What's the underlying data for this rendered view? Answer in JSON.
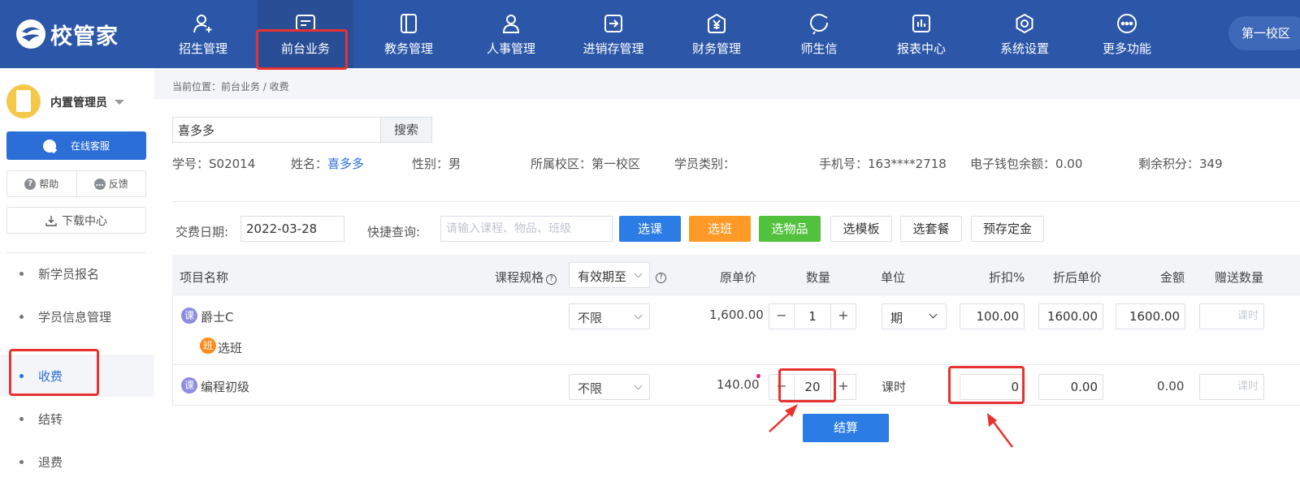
{
  "brand": {
    "name": "校管家"
  },
  "nav": {
    "items": [
      {
        "key": "recruit",
        "label": "招生管理",
        "icon": "user-plus-icon"
      },
      {
        "key": "front",
        "label": "前台业务",
        "icon": "front-desk-icon",
        "active": true
      },
      {
        "key": "academic",
        "label": "教务管理",
        "icon": "book-icon"
      },
      {
        "key": "hr",
        "label": "人事管理",
        "icon": "person-icon"
      },
      {
        "key": "inventory",
        "label": "进销存管理",
        "icon": "inventory-icon"
      },
      {
        "key": "finance",
        "label": "财务管理",
        "icon": "yen-icon"
      },
      {
        "key": "message",
        "label": "师生信",
        "icon": "message-icon"
      },
      {
        "key": "report",
        "label": "报表中心",
        "icon": "chart-icon"
      },
      {
        "key": "settings",
        "label": "系统设置",
        "icon": "gear-icon"
      },
      {
        "key": "more",
        "label": "更多功能",
        "icon": "more-icon"
      }
    ],
    "campus": "第一校区"
  },
  "sidebar": {
    "user_name": "内置管理员",
    "online_service": "在线客服",
    "help": "帮助",
    "feedback": "反馈",
    "download": "下载中心",
    "menu": [
      {
        "label": "新学员报名"
      },
      {
        "label": "学员信息管理"
      },
      {
        "label": "收费",
        "active": true
      },
      {
        "label": "结转"
      },
      {
        "label": "退费"
      }
    ]
  },
  "breadcrumb": "当前位置：前台业务 / 收费",
  "search": {
    "value": "喜多多",
    "button": "搜索"
  },
  "student": {
    "id_label": "学号：S02014",
    "name_label": "姓名：",
    "name_value": "喜多多",
    "gender": "性别：男",
    "campus": "所属校区：第一校区",
    "category": "学员类别：",
    "phone": "手机号：163****2718",
    "wallet": "电子钱包余额：0.00",
    "points": "剩余积分：349"
  },
  "filters": {
    "date_label": "交费日期:",
    "date_value": "2022-03-28",
    "quick_label": "快捷查询:",
    "quick_placeholder": "请输入课程、物品、班级",
    "buttons": {
      "course": "选课",
      "class": "选班",
      "goods": "选物品",
      "template": "选模板",
      "package": "选套餐",
      "deposit": "预存定金"
    }
  },
  "table": {
    "headers": {
      "name": "项目名称",
      "spec": "课程规格",
      "valid_until": "有效期至",
      "price": "原单价",
      "qty": "数量",
      "unit": "单位",
      "discount": "折扣%",
      "discounted_price": "折后单价",
      "amount": "金额",
      "gift_qty": "赠送数量"
    },
    "rows": [
      {
        "badge": "课",
        "name": "爵士C",
        "sub_badge": "班",
        "sub_label": "选班",
        "validity": "不限",
        "price": "1,600.00",
        "qty": "1",
        "unit": "期",
        "discount": "100.00",
        "discounted_price": "1600.00",
        "amount": "1600.00",
        "gift_placeholder": "课时"
      },
      {
        "badge": "课",
        "name": "编程初级",
        "validity": "不限",
        "price": "140.00",
        "qty": "20",
        "unit": "课时",
        "discount": "0",
        "discounted_price": "0.00",
        "amount": "0.00",
        "gift_placeholder": "课时"
      }
    ]
  },
  "settle_button": "结算",
  "colors": {
    "nav": "#2c57a8",
    "primary": "#2c7ce5",
    "orange": "#ff9a26",
    "green": "#52c13d",
    "annotation": "#e8322f"
  }
}
